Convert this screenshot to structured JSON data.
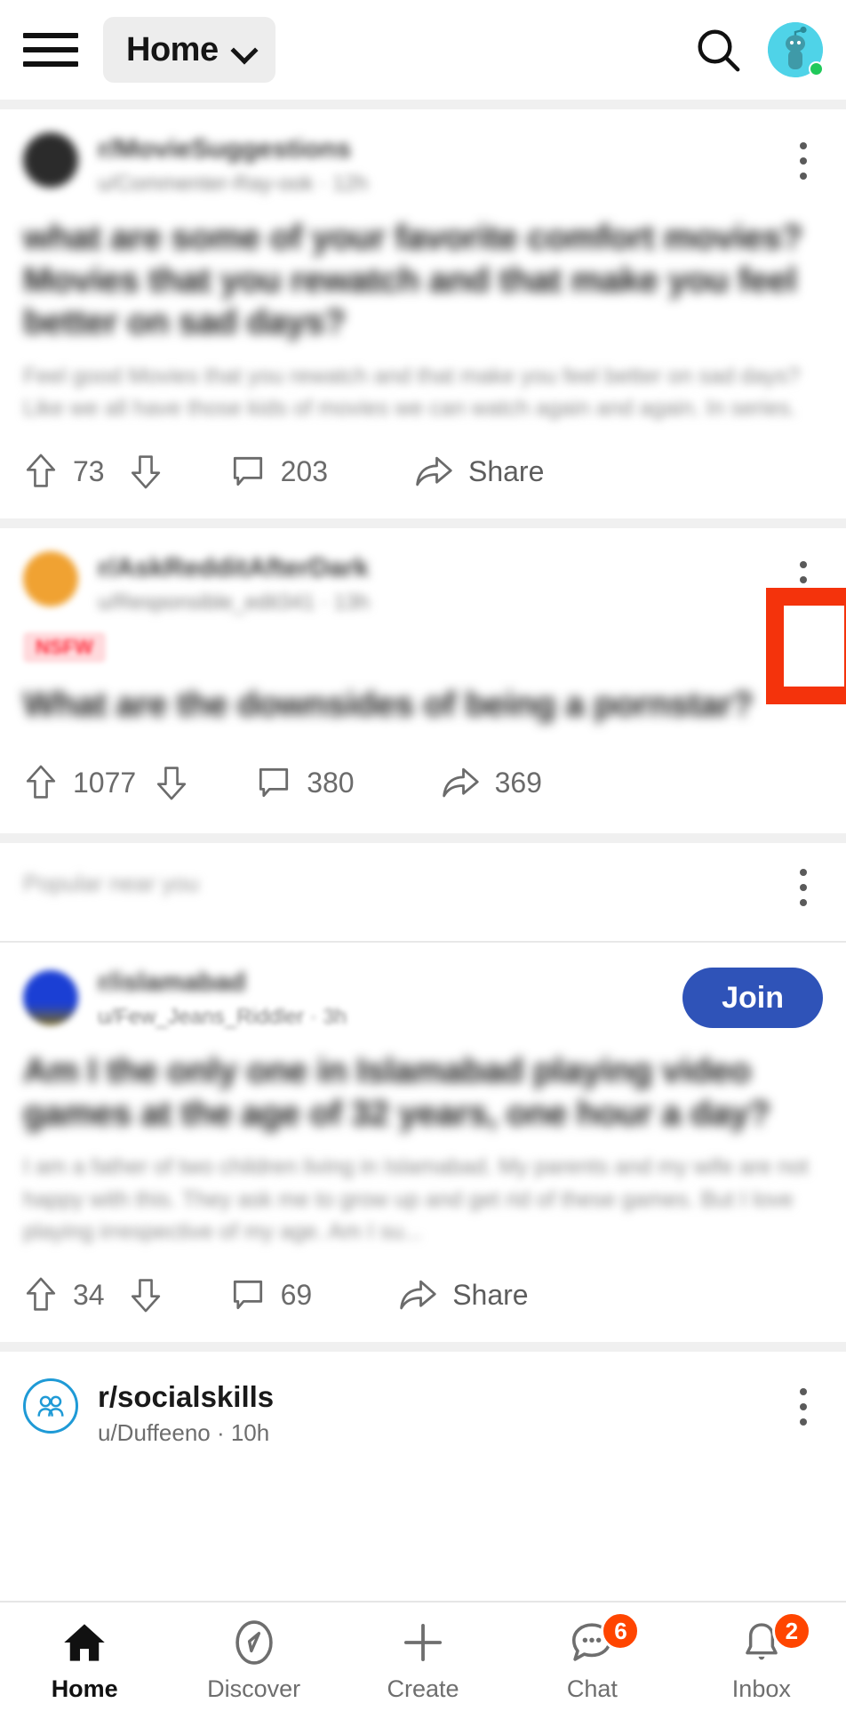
{
  "header": {
    "menu_icon": "hamburger-menu-icon",
    "feed_selector_label": "Home",
    "chevron_icon": "chevron-down-icon",
    "search_icon": "search-icon",
    "avatar_icon": "user-avatar-snoo",
    "avatar_color": "#4fd3e8",
    "status_color": "#20c95a"
  },
  "posts": [
    {
      "subreddit": "r/MovieSuggestions",
      "byline": "u/Commenter-Ray-ook  ·  12h",
      "title": "what are some of your favorite comfort movies? Movies that you rewatch and that make you feel better on sad days?",
      "body": "Feel good Movies that you rewatch and that make you feel better on sad days? Like we all have those kids of movies we can watch again and again. In series.",
      "avatar_color": "#2b2b2b",
      "redacted": true,
      "kebab_icon": "overflow-menu-icon",
      "upvotes": "73",
      "comments": "203",
      "share_label": "Share",
      "has_share_count": false
    },
    {
      "subreddit": "r/AskRedditAfterDark",
      "byline": "u/Responsible_edit341  ·  13h",
      "tag": "NSFW",
      "title": "What are the downsides of being a pornstar?",
      "avatar_color": "#f0a232",
      "redacted": true,
      "kebab_icon": "overflow-menu-icon",
      "upvotes": "1077",
      "comments": "380",
      "shares": "369",
      "has_share_count": true,
      "highlighted": true
    },
    {
      "section_label": "Popular near you",
      "subreddit": "r/islamabad",
      "byline": "u/Few_Jeans_Riddler · 3h",
      "title": "Am I the only one in Islamabad playing video games at the age of 32 years, one hour a day?",
      "body": "I am a father of two children living in Islamabad. My parents and my wife are not happy with this. They ask me to grow up and get rid of these games. But I love playing irrespective of my age. Am I su...",
      "avatar_color": "#1b3fd4",
      "redacted": true,
      "kebab_icon": "overflow-menu-icon",
      "join_label": "Join",
      "upvotes": "34",
      "comments": "69",
      "share_label": "Share",
      "has_share_count": false
    },
    {
      "subreddit": "r/socialskills",
      "byline": "u/Duffeeno · 10h",
      "redacted": false,
      "kebab_icon": "overflow-menu-icon",
      "partial": true
    }
  ],
  "icons": {
    "upvote": "upvote-arrow-icon",
    "downvote": "downvote-arrow-icon",
    "comment": "comment-bubble-icon",
    "share": "share-arrow-icon"
  },
  "annotation": {
    "color": "#f4330c",
    "target": "post-2-overflow-menu"
  },
  "bottom_nav": [
    {
      "label": "Home",
      "icon": "home-icon",
      "active": true,
      "badge": null
    },
    {
      "label": "Discover",
      "icon": "compass-icon",
      "active": false,
      "badge": null
    },
    {
      "label": "Create",
      "icon": "plus-icon",
      "active": false,
      "badge": null
    },
    {
      "label": "Chat",
      "icon": "chat-bubble-icon",
      "active": false,
      "badge": "6"
    },
    {
      "label": "Inbox",
      "icon": "bell-icon",
      "active": false,
      "badge": "2"
    }
  ],
  "badge_color": "#ff4500"
}
